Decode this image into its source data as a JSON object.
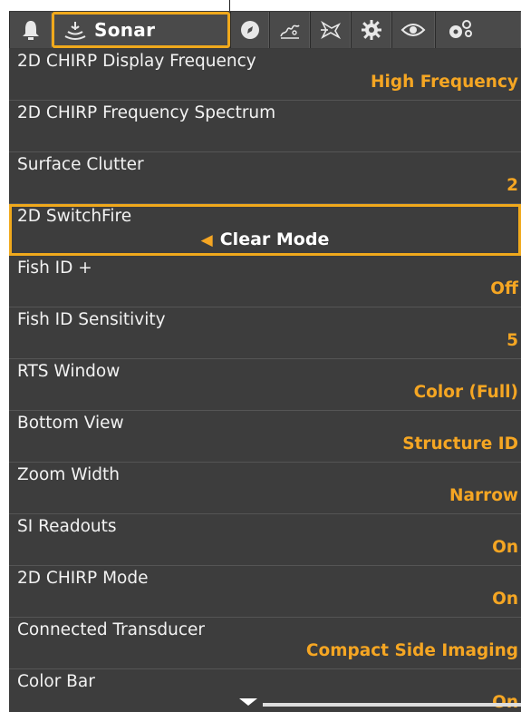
{
  "tabs": [
    {
      "name": "alarms",
      "icon": "bell-icon",
      "label": ""
    },
    {
      "name": "sonar",
      "icon": "sonar-icon",
      "label": "Sonar",
      "active": true
    },
    {
      "name": "navigation",
      "icon": "compass-icon",
      "label": ""
    },
    {
      "name": "chart",
      "icon": "map-icon",
      "label": ""
    },
    {
      "name": "fish",
      "icon": "fish-icon",
      "label": ""
    },
    {
      "name": "setup",
      "icon": "gear-icon",
      "label": ""
    },
    {
      "name": "views",
      "icon": "eye-icon",
      "label": ""
    },
    {
      "name": "accessories",
      "icon": "gears-icon",
      "label": ""
    }
  ],
  "rows": [
    {
      "label": "2D CHIRP Display Frequency",
      "value": "High Frequency"
    },
    {
      "label": "2D CHIRP Frequency Spectrum",
      "value": ""
    },
    {
      "label": "Surface Clutter",
      "value": "2"
    },
    {
      "label": "2D SwitchFire",
      "value": "Clear Mode",
      "selected": true
    },
    {
      "label": "Fish ID +",
      "value": "Off"
    },
    {
      "label": "Fish ID Sensitivity",
      "value": "5"
    },
    {
      "label": "RTS Window",
      "value": "Color (Full)"
    },
    {
      "label": "Bottom View",
      "value": "Structure ID"
    },
    {
      "label": "Zoom Width",
      "value": "Narrow"
    },
    {
      "label": "SI Readouts",
      "value": "On"
    },
    {
      "label": "2D CHIRP Mode",
      "value": "On"
    },
    {
      "label": "Connected Transducer",
      "value": "Compact Side Imaging"
    },
    {
      "label": "Color Bar",
      "value": "On"
    }
  ],
  "colors": {
    "accent": "#f0a91c",
    "value_text": "#f5a623",
    "panel_bg": "#3a3a3a"
  }
}
